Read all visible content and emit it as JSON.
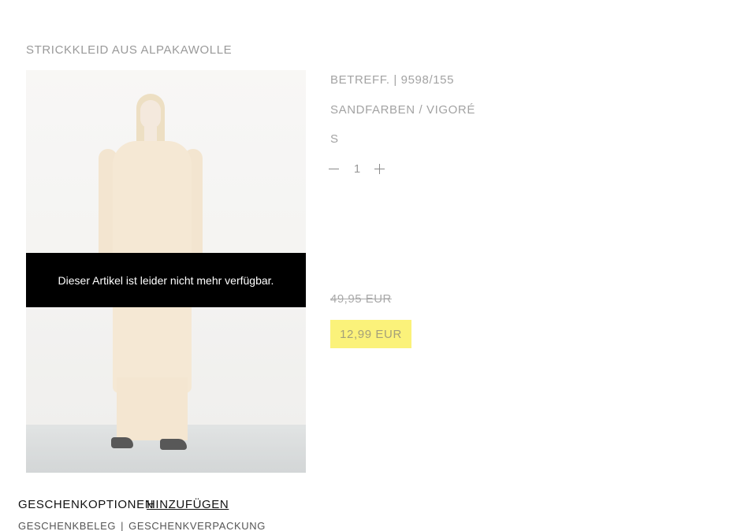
{
  "product": {
    "title": "STRICKKLEID AUS ALPAKAWOLLE",
    "reference": "BETREFF. | 9598/155",
    "color": "SANDFARBEN / VIGORÉ",
    "size": "S",
    "quantity": "1",
    "unavailable_message": "Dieser Artikel ist leider nicht mehr verfügbar.",
    "old_price": "49,95 EUR",
    "new_price": "12,99 EUR"
  },
  "gift": {
    "label": "GESCHENKOPTIONEN",
    "add_label": "HINZUFÜGEN",
    "option_receipt": "GESCHENKBELEG",
    "separator": "|",
    "option_wrapping": "GESCHENKVERPACKUNG"
  },
  "colors": {
    "banner_bg": "#000000",
    "price_highlight": "#fbf27a"
  },
  "icons": {
    "minus": "minus-icon",
    "plus": "plus-icon"
  }
}
